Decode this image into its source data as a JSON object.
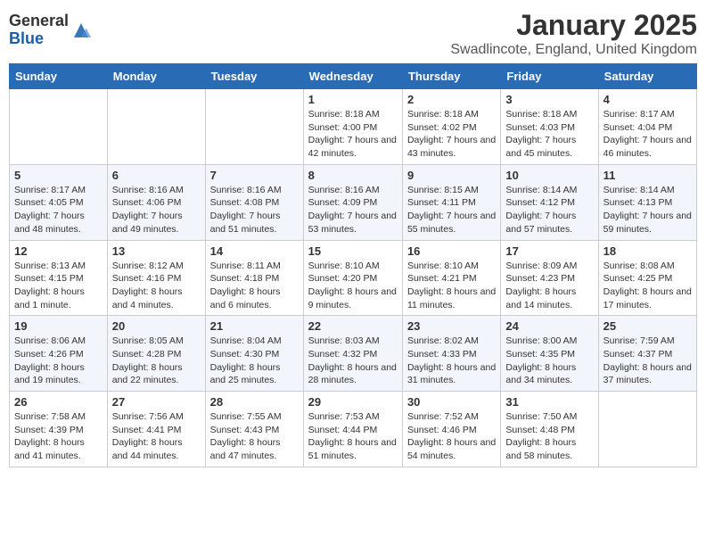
{
  "header": {
    "logo_general": "General",
    "logo_blue": "Blue",
    "month_title": "January 2025",
    "location": "Swadlincote, England, United Kingdom"
  },
  "days_of_week": [
    "Sunday",
    "Monday",
    "Tuesday",
    "Wednesday",
    "Thursday",
    "Friday",
    "Saturday"
  ],
  "weeks": [
    [
      {
        "day": "",
        "info": ""
      },
      {
        "day": "",
        "info": ""
      },
      {
        "day": "",
        "info": ""
      },
      {
        "day": "1",
        "info": "Sunrise: 8:18 AM\nSunset: 4:00 PM\nDaylight: 7 hours and 42 minutes."
      },
      {
        "day": "2",
        "info": "Sunrise: 8:18 AM\nSunset: 4:02 PM\nDaylight: 7 hours and 43 minutes."
      },
      {
        "day": "3",
        "info": "Sunrise: 8:18 AM\nSunset: 4:03 PM\nDaylight: 7 hours and 45 minutes."
      },
      {
        "day": "4",
        "info": "Sunrise: 8:17 AM\nSunset: 4:04 PM\nDaylight: 7 hours and 46 minutes."
      }
    ],
    [
      {
        "day": "5",
        "info": "Sunrise: 8:17 AM\nSunset: 4:05 PM\nDaylight: 7 hours and 48 minutes."
      },
      {
        "day": "6",
        "info": "Sunrise: 8:16 AM\nSunset: 4:06 PM\nDaylight: 7 hours and 49 minutes."
      },
      {
        "day": "7",
        "info": "Sunrise: 8:16 AM\nSunset: 4:08 PM\nDaylight: 7 hours and 51 minutes."
      },
      {
        "day": "8",
        "info": "Sunrise: 8:16 AM\nSunset: 4:09 PM\nDaylight: 7 hours and 53 minutes."
      },
      {
        "day": "9",
        "info": "Sunrise: 8:15 AM\nSunset: 4:11 PM\nDaylight: 7 hours and 55 minutes."
      },
      {
        "day": "10",
        "info": "Sunrise: 8:14 AM\nSunset: 4:12 PM\nDaylight: 7 hours and 57 minutes."
      },
      {
        "day": "11",
        "info": "Sunrise: 8:14 AM\nSunset: 4:13 PM\nDaylight: 7 hours and 59 minutes."
      }
    ],
    [
      {
        "day": "12",
        "info": "Sunrise: 8:13 AM\nSunset: 4:15 PM\nDaylight: 8 hours and 1 minute."
      },
      {
        "day": "13",
        "info": "Sunrise: 8:12 AM\nSunset: 4:16 PM\nDaylight: 8 hours and 4 minutes."
      },
      {
        "day": "14",
        "info": "Sunrise: 8:11 AM\nSunset: 4:18 PM\nDaylight: 8 hours and 6 minutes."
      },
      {
        "day": "15",
        "info": "Sunrise: 8:10 AM\nSunset: 4:20 PM\nDaylight: 8 hours and 9 minutes."
      },
      {
        "day": "16",
        "info": "Sunrise: 8:10 AM\nSunset: 4:21 PM\nDaylight: 8 hours and 11 minutes."
      },
      {
        "day": "17",
        "info": "Sunrise: 8:09 AM\nSunset: 4:23 PM\nDaylight: 8 hours and 14 minutes."
      },
      {
        "day": "18",
        "info": "Sunrise: 8:08 AM\nSunset: 4:25 PM\nDaylight: 8 hours and 17 minutes."
      }
    ],
    [
      {
        "day": "19",
        "info": "Sunrise: 8:06 AM\nSunset: 4:26 PM\nDaylight: 8 hours and 19 minutes."
      },
      {
        "day": "20",
        "info": "Sunrise: 8:05 AM\nSunset: 4:28 PM\nDaylight: 8 hours and 22 minutes."
      },
      {
        "day": "21",
        "info": "Sunrise: 8:04 AM\nSunset: 4:30 PM\nDaylight: 8 hours and 25 minutes."
      },
      {
        "day": "22",
        "info": "Sunrise: 8:03 AM\nSunset: 4:32 PM\nDaylight: 8 hours and 28 minutes."
      },
      {
        "day": "23",
        "info": "Sunrise: 8:02 AM\nSunset: 4:33 PM\nDaylight: 8 hours and 31 minutes."
      },
      {
        "day": "24",
        "info": "Sunrise: 8:00 AM\nSunset: 4:35 PM\nDaylight: 8 hours and 34 minutes."
      },
      {
        "day": "25",
        "info": "Sunrise: 7:59 AM\nSunset: 4:37 PM\nDaylight: 8 hours and 37 minutes."
      }
    ],
    [
      {
        "day": "26",
        "info": "Sunrise: 7:58 AM\nSunset: 4:39 PM\nDaylight: 8 hours and 41 minutes."
      },
      {
        "day": "27",
        "info": "Sunrise: 7:56 AM\nSunset: 4:41 PM\nDaylight: 8 hours and 44 minutes."
      },
      {
        "day": "28",
        "info": "Sunrise: 7:55 AM\nSunset: 4:43 PM\nDaylight: 8 hours and 47 minutes."
      },
      {
        "day": "29",
        "info": "Sunrise: 7:53 AM\nSunset: 4:44 PM\nDaylight: 8 hours and 51 minutes."
      },
      {
        "day": "30",
        "info": "Sunrise: 7:52 AM\nSunset: 4:46 PM\nDaylight: 8 hours and 54 minutes."
      },
      {
        "day": "31",
        "info": "Sunrise: 7:50 AM\nSunset: 4:48 PM\nDaylight: 8 hours and 58 minutes."
      },
      {
        "day": "",
        "info": ""
      }
    ]
  ]
}
